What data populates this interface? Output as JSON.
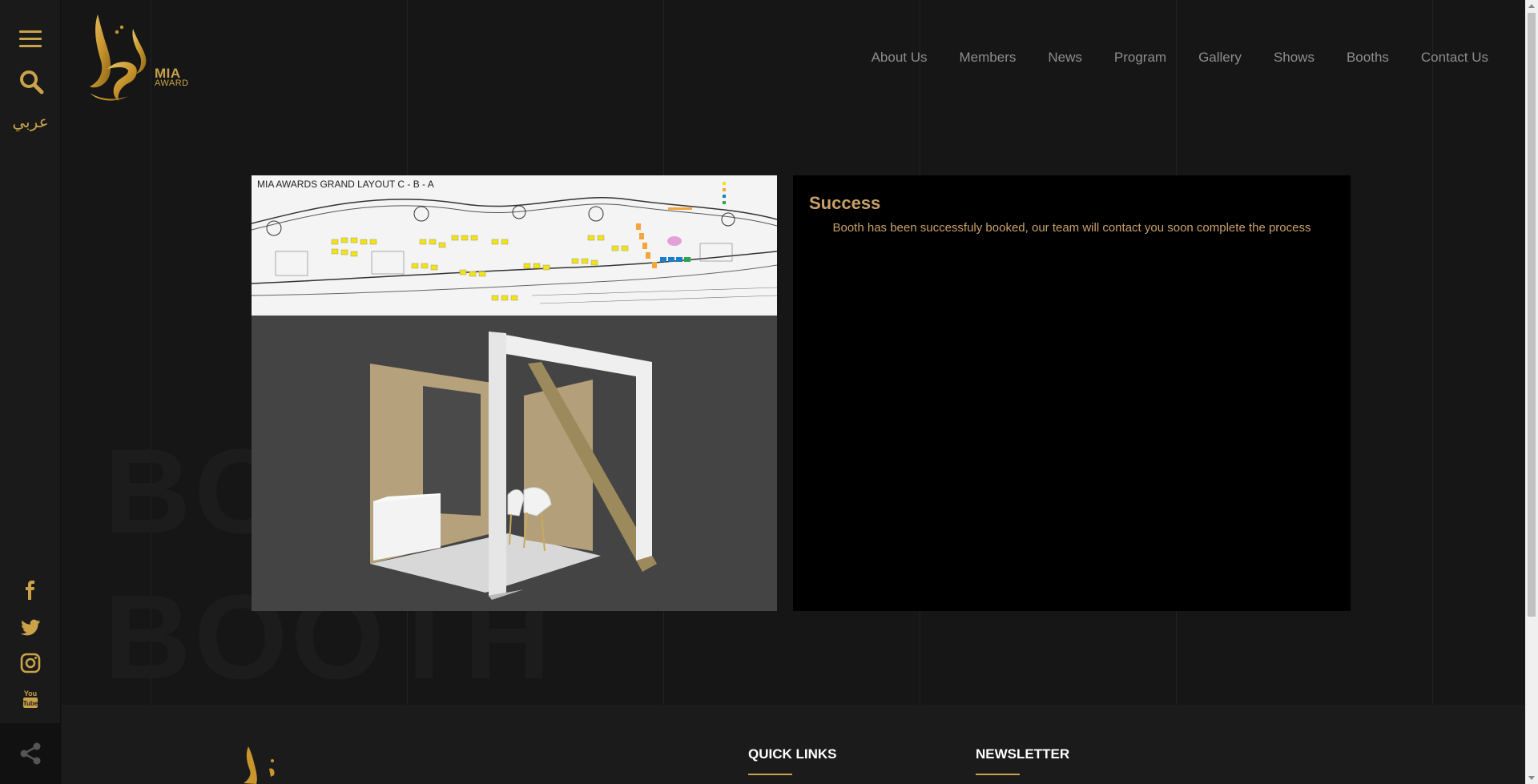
{
  "sidebar": {
    "language_label": "عربي",
    "social_icons": [
      "facebook-icon",
      "twitter-icon",
      "instagram-icon",
      "youtube-icon"
    ]
  },
  "brand": {
    "line1": "MIA",
    "line2": "AWARD"
  },
  "nav": {
    "items": [
      "About Us",
      "Members",
      "News",
      "Program",
      "Gallery",
      "Shows",
      "Booths",
      "Contact Us"
    ]
  },
  "watermark": {
    "line1": "BO",
    "line2": "BOOTH"
  },
  "floorplan": {
    "title": "MIA AWARDS GRAND LAYOUT C - B - A"
  },
  "result": {
    "title": "Success",
    "message": "Booth has been successfuly booked, our team will contact you soon complete the process"
  },
  "footer": {
    "quick_links": "QUICK LINKS",
    "newsletter": "NEWSLETTER"
  },
  "colors": {
    "accent": "#c9a24a",
    "message_text": "#c9a06a",
    "background": "#161616"
  }
}
